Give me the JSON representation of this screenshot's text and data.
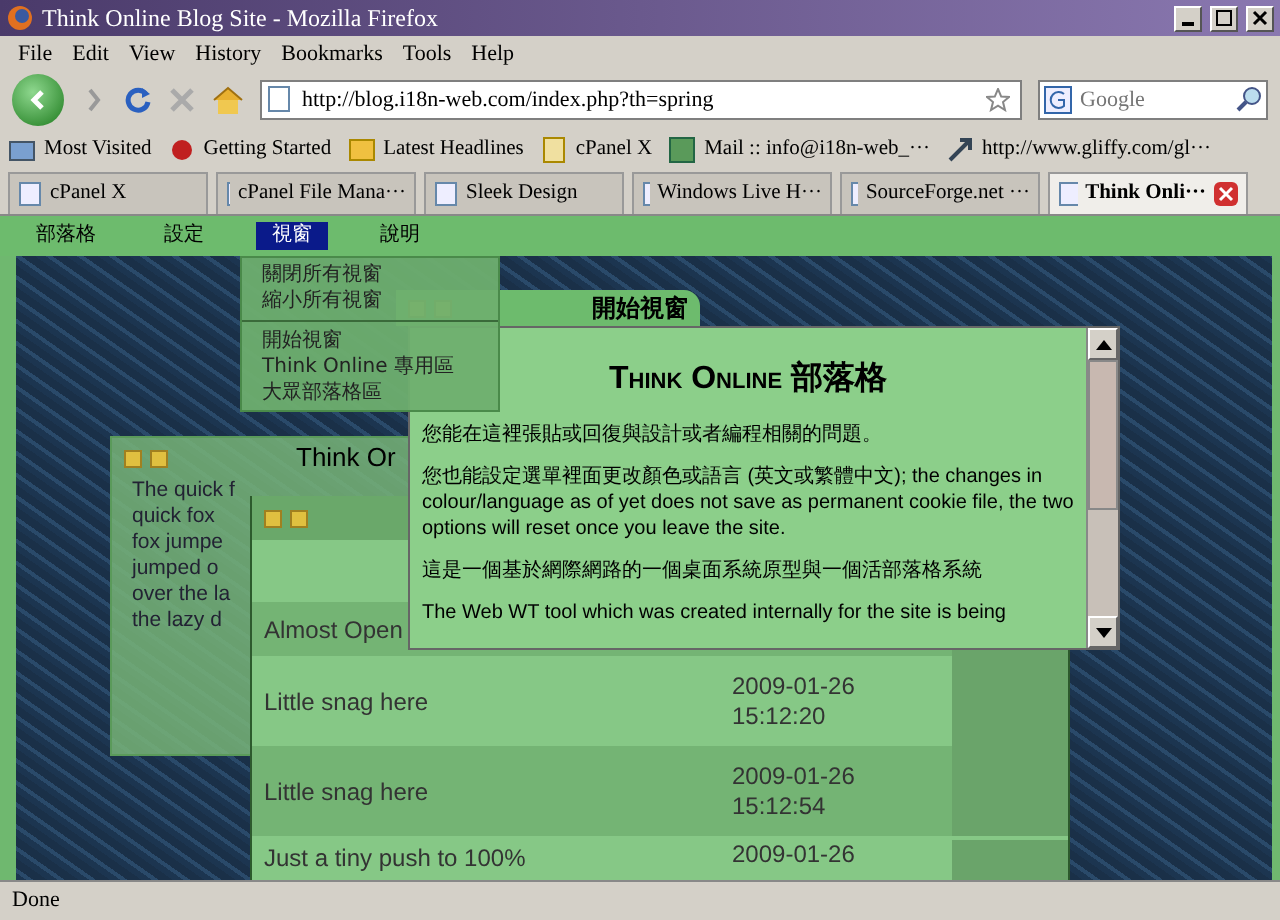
{
  "window": {
    "title": "Think Online Blog Site - Mozilla Firefox"
  },
  "menu_bar": [
    "File",
    "Edit",
    "View",
    "History",
    "Bookmarks",
    "Tools",
    "Help"
  ],
  "address_bar": {
    "value": "http://blog.i18n-web.com/index.php?th=spring"
  },
  "search": {
    "placeholder": "Google"
  },
  "bookmarks": [
    {
      "label": "Most Visited",
      "kind": "folder"
    },
    {
      "label": "Getting Started",
      "kind": "leaf"
    },
    {
      "label": "Latest Headlines",
      "kind": "feed"
    },
    {
      "label": "cPanel X",
      "kind": "page"
    },
    {
      "label": "Mail :: info@i18n-web_···",
      "kind": "mail"
    },
    {
      "label": "http://www.gliffy.com/gl···",
      "kind": "link"
    }
  ],
  "tabs": [
    {
      "label": "cPanel X",
      "selected": false
    },
    {
      "label": "cPanel File Mana···",
      "selected": false
    },
    {
      "label": "Sleek Design",
      "selected": false
    },
    {
      "label": "Windows Live H···",
      "selected": false
    },
    {
      "label": "SourceForge.net ···",
      "selected": false
    },
    {
      "label": "Think Onli···",
      "selected": true
    }
  ],
  "site_menu": [
    {
      "label": "部落格",
      "selected": false
    },
    {
      "label": "設定",
      "selected": false
    },
    {
      "label": "視窗",
      "selected": true
    },
    {
      "label": "說明",
      "selected": false
    }
  ],
  "window_menu": [
    {
      "kind": "item",
      "label": "關閉所有視窗"
    },
    {
      "kind": "item",
      "label": "縮小所有視窗"
    },
    {
      "kind": "separator"
    },
    {
      "kind": "item",
      "label": "開始視窗"
    },
    {
      "kind": "item",
      "label": "Think Online 專用區"
    },
    {
      "kind": "item",
      "label": "大眾部落格區"
    }
  ],
  "fox_window": {
    "title": "Think Or",
    "lines": [
      "The quick f",
      "quick fox",
      "fox jumpe",
      "jumped o",
      "over the la",
      "the lazy d"
    ]
  },
  "list_window": {
    "rows": [
      {
        "title": "Almost Open"
      },
      {
        "title": "Little snag here",
        "date": "2009-01-26",
        "time": "15:12:20"
      },
      {
        "title": "Little snag here",
        "date": "2009-01-26",
        "time": "15:12:54"
      },
      {
        "title": "Just a tiny push to 100%",
        "date": "2009-01-26"
      }
    ]
  },
  "start_window": {
    "title": "開始視窗",
    "heading": "Think Online 部落格",
    "paragraphs": [
      "您能在這裡張貼或回復與設計或者編程相關的問題。",
      "您也能設定選單裡面更改顏色或語言 (英文或繁體中文); the changes in colour/language as of yet does not save as permanent cookie file, the two options will reset once you leave the site.",
      "這是一個基於網際網路的一個桌面系統原型與一個活部落格系統",
      "The Web WT tool which was created internally for the site is being"
    ]
  },
  "status_bar": {
    "text": "Done"
  }
}
